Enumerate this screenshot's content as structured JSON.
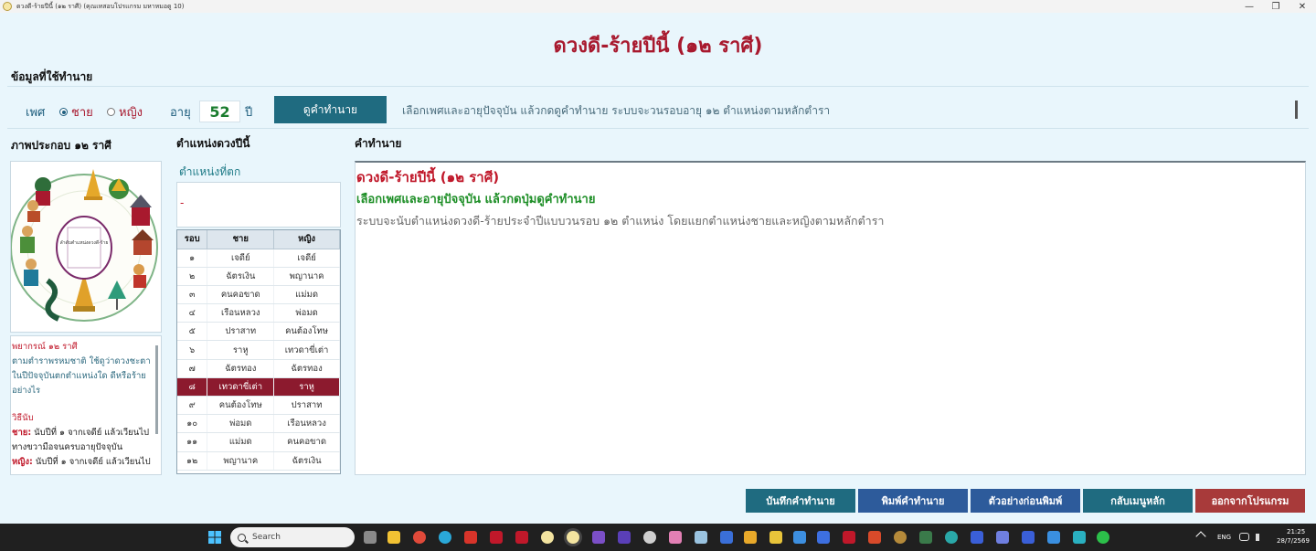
{
  "window": {
    "title": "ดวงดี-ร้ายปีนี้ (๑๒ ราศี) (คุณเทสอบโปรแกรม มหาหมอดู 10)",
    "min_glyph": "—",
    "max_glyph": "❐",
    "close_glyph": "✕"
  },
  "header": {
    "title": "ดวงดี-ร้ายปีนี้ (๑๒ ราศี)"
  },
  "info_section": {
    "label": "ข้อมูลที่ใช้ทำนาย"
  },
  "controls": {
    "gender_label": "เพศ",
    "male_label": "ชาย",
    "female_label": "หญิง",
    "age_label": "อายุ",
    "age_value": "52",
    "age_unit": "ปี",
    "predict_button": "ดูคำทำนาย",
    "hint": "เลือกเพศและอายุปัจจุบัน แล้วกดดูคำทำนาย ระบบจะวนรอบอายุ ๑๒ ตำแหน่งตามหลักตำรา",
    "selected_gender": "male"
  },
  "left_panel": {
    "label": "ภาพประกอบ ๑๒ ราศี",
    "image_center_text": "ลำดับตำแหน่งดวงดี-ร้าย",
    "note": {
      "title": "พยากรณ์ ๑๒ ราศี",
      "desc": "ตามตำราพรหมชาติ ใช้ดูว่าดวงชะตาในปีปัจจุบันตกตำแหน่งใด ดีหรือร้ายอย่างไร",
      "method_title": "วิธีนับ",
      "male_tag": "ชาย:",
      "male_text": " นับปีที่ ๑ จากเจดีย์ แล้วเวียนไปทางขวามือจนครบอายุปัจจุบัน",
      "female_tag": "หญิง:",
      "female_text": " นับปีที่ ๑ จากเจดีย์ แล้วเวียนไป"
    }
  },
  "middle_panel": {
    "label": "ตำแหน่งดวงปีนี้",
    "position_label": "ตำแหน่งที่ตก",
    "position_value": "-",
    "table": {
      "headers": [
        "รอบ",
        "ชาย",
        "หญิง"
      ],
      "rows": [
        [
          "๑",
          "เจดีย์",
          "เจดีย์"
        ],
        [
          "๒",
          "ฉัตรเงิน",
          "พญานาค"
        ],
        [
          "๓",
          "คนคอขาด",
          "แม่มด"
        ],
        [
          "๔",
          "เรือนหลวง",
          "พ่อมด"
        ],
        [
          "๕",
          "ปราสาท",
          "คนต้องโทษ"
        ],
        [
          "๖",
          "ราหู",
          "เทวดาขี่เต่า"
        ],
        [
          "๗",
          "ฉัตรทอง",
          "ฉัตรทอง"
        ],
        [
          "๘",
          "เทวดาขี่เต่า",
          "ราหู"
        ],
        [
          "๙",
          "คนต้องโทษ",
          "ปราสาท"
        ],
        [
          "๑๐",
          "พ่อมด",
          "เรือนหลวง"
        ],
        [
          "๑๑",
          "แม่มด",
          "คนคอขาด"
        ],
        [
          "๑๒",
          "พญานาค",
          "ฉัตรเงิน"
        ]
      ],
      "selected_row": 7
    }
  },
  "result_panel": {
    "label": "คำทำนาย",
    "title": "ดวงดี-ร้ายปีนี้ (๑๒ ราศี)",
    "subtitle": "เลือกเพศและอายุปัจจุบัน แล้วกดปุ่มดูคำทำนาย",
    "body": "ระบบจะนับตำแหน่งดวงดี-ร้ายประจำปีแบบวนรอบ ๑๒ ตำแหน่ง โดยแยกตำแหน่งชายและหญิงตามหลักตำรา"
  },
  "bottom_buttons": {
    "save": "บันทึกคำทำนาย",
    "print": "พิมพ์คำทำนาย",
    "preview": "ตัวอย่างก่อนพิมพ์",
    "menu": "กลับเมนูหลัก",
    "exit": "ออกจากโปรแกรม"
  },
  "taskbar": {
    "search_placeholder": "Search",
    "lang": "ENG",
    "time": "21:25",
    "date": "28/7/2569"
  },
  "colors": {
    "title_red": "#a8192e",
    "button_teal": "#1f6b80",
    "button_blue": "#2d5b9b",
    "button_exit": "#a83a3a",
    "selected_row": "#8c1a2e",
    "green_text": "#1f8f28"
  }
}
